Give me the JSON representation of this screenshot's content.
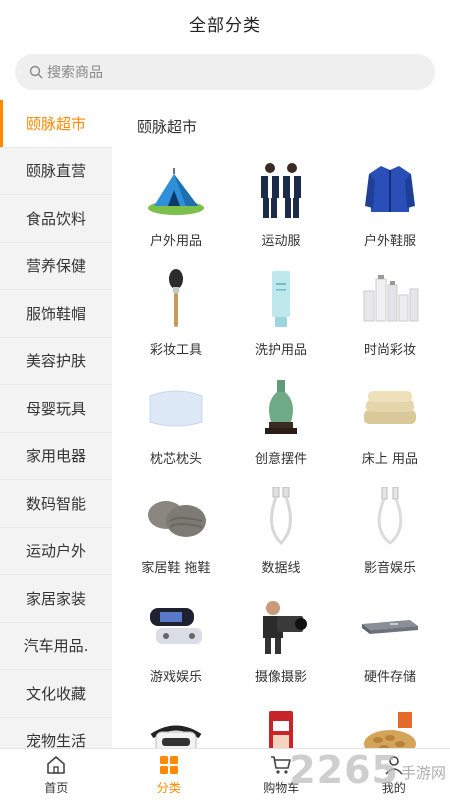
{
  "header": {
    "title": "全部分类"
  },
  "search": {
    "placeholder": "搜索商品"
  },
  "sidebar": {
    "active_index": 0,
    "items": [
      {
        "label": "颐脉超市"
      },
      {
        "label": "颐脉直营"
      },
      {
        "label": "食品饮料"
      },
      {
        "label": "营养保健"
      },
      {
        "label": "服饰鞋帽"
      },
      {
        "label": "美容护肤"
      },
      {
        "label": "母婴玩具"
      },
      {
        "label": "家用电器"
      },
      {
        "label": "数码智能"
      },
      {
        "label": "运动户外"
      },
      {
        "label": "家居家装"
      },
      {
        "label": "汽车用品."
      },
      {
        "label": "文化收藏"
      },
      {
        "label": "宠物生活"
      }
    ]
  },
  "main": {
    "section_title": "颐脉超市",
    "categories": [
      {
        "label": "户外用品",
        "icon": "tent-image"
      },
      {
        "label": "运动服",
        "icon": "sportswear-image"
      },
      {
        "label": "户外鞋服",
        "icon": "jacket-image"
      },
      {
        "label": "彩妆工具",
        "icon": "makeup-brush-image"
      },
      {
        "label": "洗护用品",
        "icon": "cleanser-tube-image"
      },
      {
        "label": "时尚彩妆",
        "icon": "cosmetics-set-image"
      },
      {
        "label": "枕芯枕头",
        "icon": "pillow-image"
      },
      {
        "label": "创意摆件",
        "icon": "vase-image"
      },
      {
        "label": "床上 用品",
        "icon": "folded-blanket-image"
      },
      {
        "label": "家居鞋 拖鞋",
        "icon": "slippers-image"
      },
      {
        "label": "数据线",
        "icon": "usb-cable-image"
      },
      {
        "label": "影音娱乐",
        "icon": "audio-cable-image"
      },
      {
        "label": "游戏娱乐",
        "icon": "game-console-image"
      },
      {
        "label": "摄像摄影",
        "icon": "video-camera-image"
      },
      {
        "label": "硬件存储",
        "icon": "hard-drive-image"
      },
      {
        "label": "",
        "icon": "vr-headset-image"
      },
      {
        "label": "",
        "icon": "milk-powder-image"
      },
      {
        "label": "",
        "icon": "nuts-image"
      }
    ]
  },
  "tabbar": {
    "active_index": 1,
    "items": [
      {
        "label": "首页",
        "icon": "home-icon"
      },
      {
        "label": "分类",
        "icon": "grid-icon"
      },
      {
        "label": "购物车",
        "icon": "cart-icon"
      },
      {
        "label": "我的",
        "icon": "user-icon"
      }
    ]
  },
  "watermark": {
    "number": "2265",
    "text": "手游网"
  },
  "colors": {
    "accent": "#ff8a00",
    "sidebar_bg": "#f3f3f3",
    "search_bg": "#efefef"
  }
}
